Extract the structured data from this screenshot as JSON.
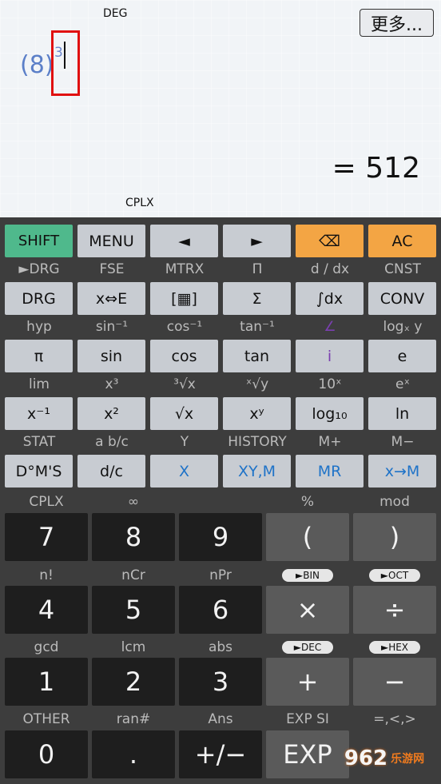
{
  "display": {
    "angle_mode": "DEG",
    "complex_indicator": "CPLX",
    "more_button": "更多...",
    "expression_paren": "(8)",
    "exponent": "3",
    "result": "= 512"
  },
  "row1": [
    "SHIFT",
    "MENU",
    "◄",
    "►",
    "⌫",
    "AC"
  ],
  "labels1": [
    "►DRG",
    "FSE",
    "MTRX",
    "Π",
    "d / dx",
    "CNST"
  ],
  "row2": [
    "DRG",
    "x⇔E",
    "[▦]",
    "Σ",
    "∫dx",
    "CONV"
  ],
  "labels2": [
    "hyp",
    "sin⁻¹",
    "cos⁻¹",
    "tan⁻¹",
    "∠",
    "logₓ y"
  ],
  "row3": [
    "π",
    "sin",
    "cos",
    "tan",
    "i",
    "e"
  ],
  "labels3": [
    "lim",
    "x³",
    "³√x",
    "ˣ√y",
    "10ˣ",
    "eˣ"
  ],
  "row4": [
    "x⁻¹",
    "x²",
    "√x",
    "xʸ",
    "log₁₀",
    "ln"
  ],
  "labels4": [
    "STAT",
    "a b/c",
    "Y",
    "HISTORY",
    "M+",
    "M−"
  ],
  "row5": [
    "D°M'S",
    "d/c",
    "X",
    "XY,M",
    "MR",
    "x→M"
  ],
  "labels5": [
    "CPLX",
    "∞",
    "",
    "%",
    "mod"
  ],
  "num1": [
    "7",
    "8",
    "9",
    "(",
    ")"
  ],
  "labels6": [
    "n!",
    "nCr",
    "nPr",
    "►BIN",
    "►OCT"
  ],
  "num2": [
    "4",
    "5",
    "6",
    "×",
    "÷"
  ],
  "labels7": [
    "gcd",
    "lcm",
    "abs",
    "►DEC",
    "►HEX"
  ],
  "num3": [
    "1",
    "2",
    "3",
    "+",
    "−"
  ],
  "labels8": [
    "OTHER",
    "ran#",
    "Ans",
    "EXP SI",
    "=,<,>"
  ],
  "num4": [
    "0",
    ".",
    "+/−",
    "EXP"
  ],
  "watermark": "962",
  "watermark_sub": "乐游网"
}
